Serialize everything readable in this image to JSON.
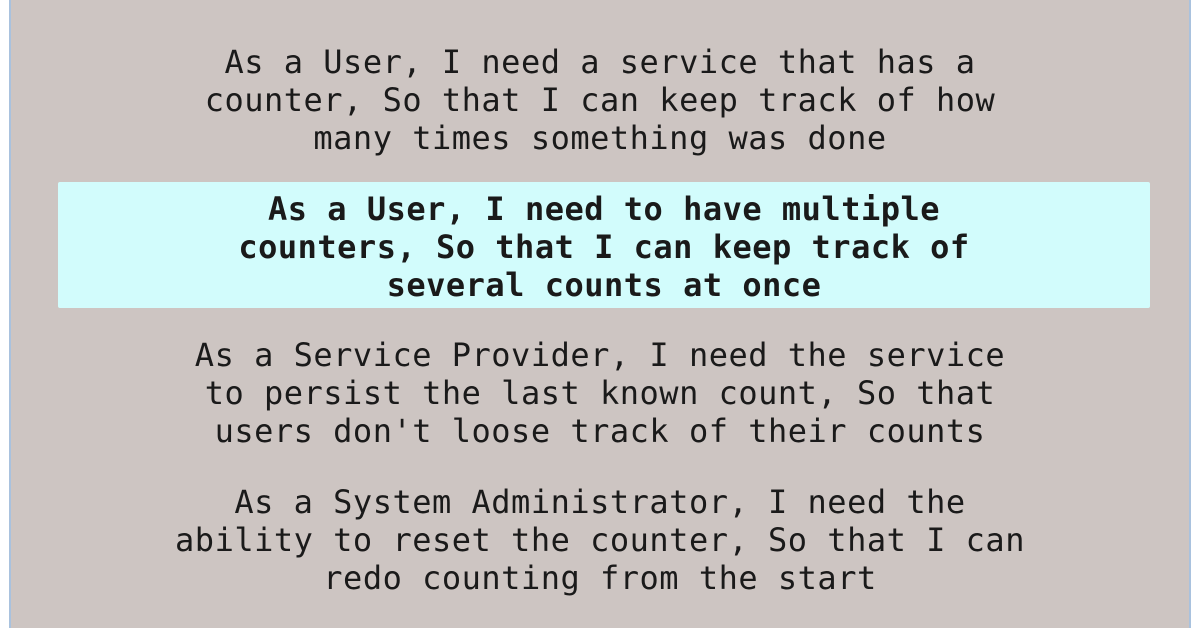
{
  "stories": [
    {
      "lines": [
        "As a User, I need a service that has a",
        "counter, So that I can keep track of how",
        "many times something was done"
      ],
      "highlighted": false
    },
    {
      "lines": [
        "As a User, I need to have multiple",
        "counters, So that I can keep track of",
        "several counts at once"
      ],
      "highlighted": true
    },
    {
      "lines": [
        "As a Service Provider, I need the service",
        "to persist the last known count, So that",
        "users don't loose track of their counts"
      ],
      "highlighted": false
    },
    {
      "lines": [
        "As a System Administrator, I need the",
        "ability to reset the counter, So that I can",
        "redo counting from the start"
      ],
      "highlighted": false
    }
  ],
  "colors": {
    "background": "#cdc5c2",
    "highlight": "#d2fcfc",
    "text": "#1a1a1a"
  }
}
